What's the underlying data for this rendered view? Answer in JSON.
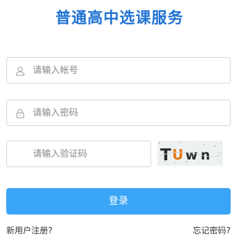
{
  "title": "普通高中选课服务",
  "form": {
    "account": {
      "placeholder": "请输入帐号",
      "value": ""
    },
    "password": {
      "placeholder": "请输入密码",
      "value": ""
    },
    "captcha": {
      "placeholder": "请输入验证码",
      "value": "",
      "image_text": "TUwn"
    },
    "login_label": "登录"
  },
  "links": {
    "register": "新用户注册?",
    "forgot_password": "忘记密码?"
  },
  "colors": {
    "title": "#1f72d3",
    "button": "#3aa4f6",
    "border": "#d4d7dd"
  },
  "icons": {
    "account": "user-icon",
    "password": "lock-icon"
  }
}
